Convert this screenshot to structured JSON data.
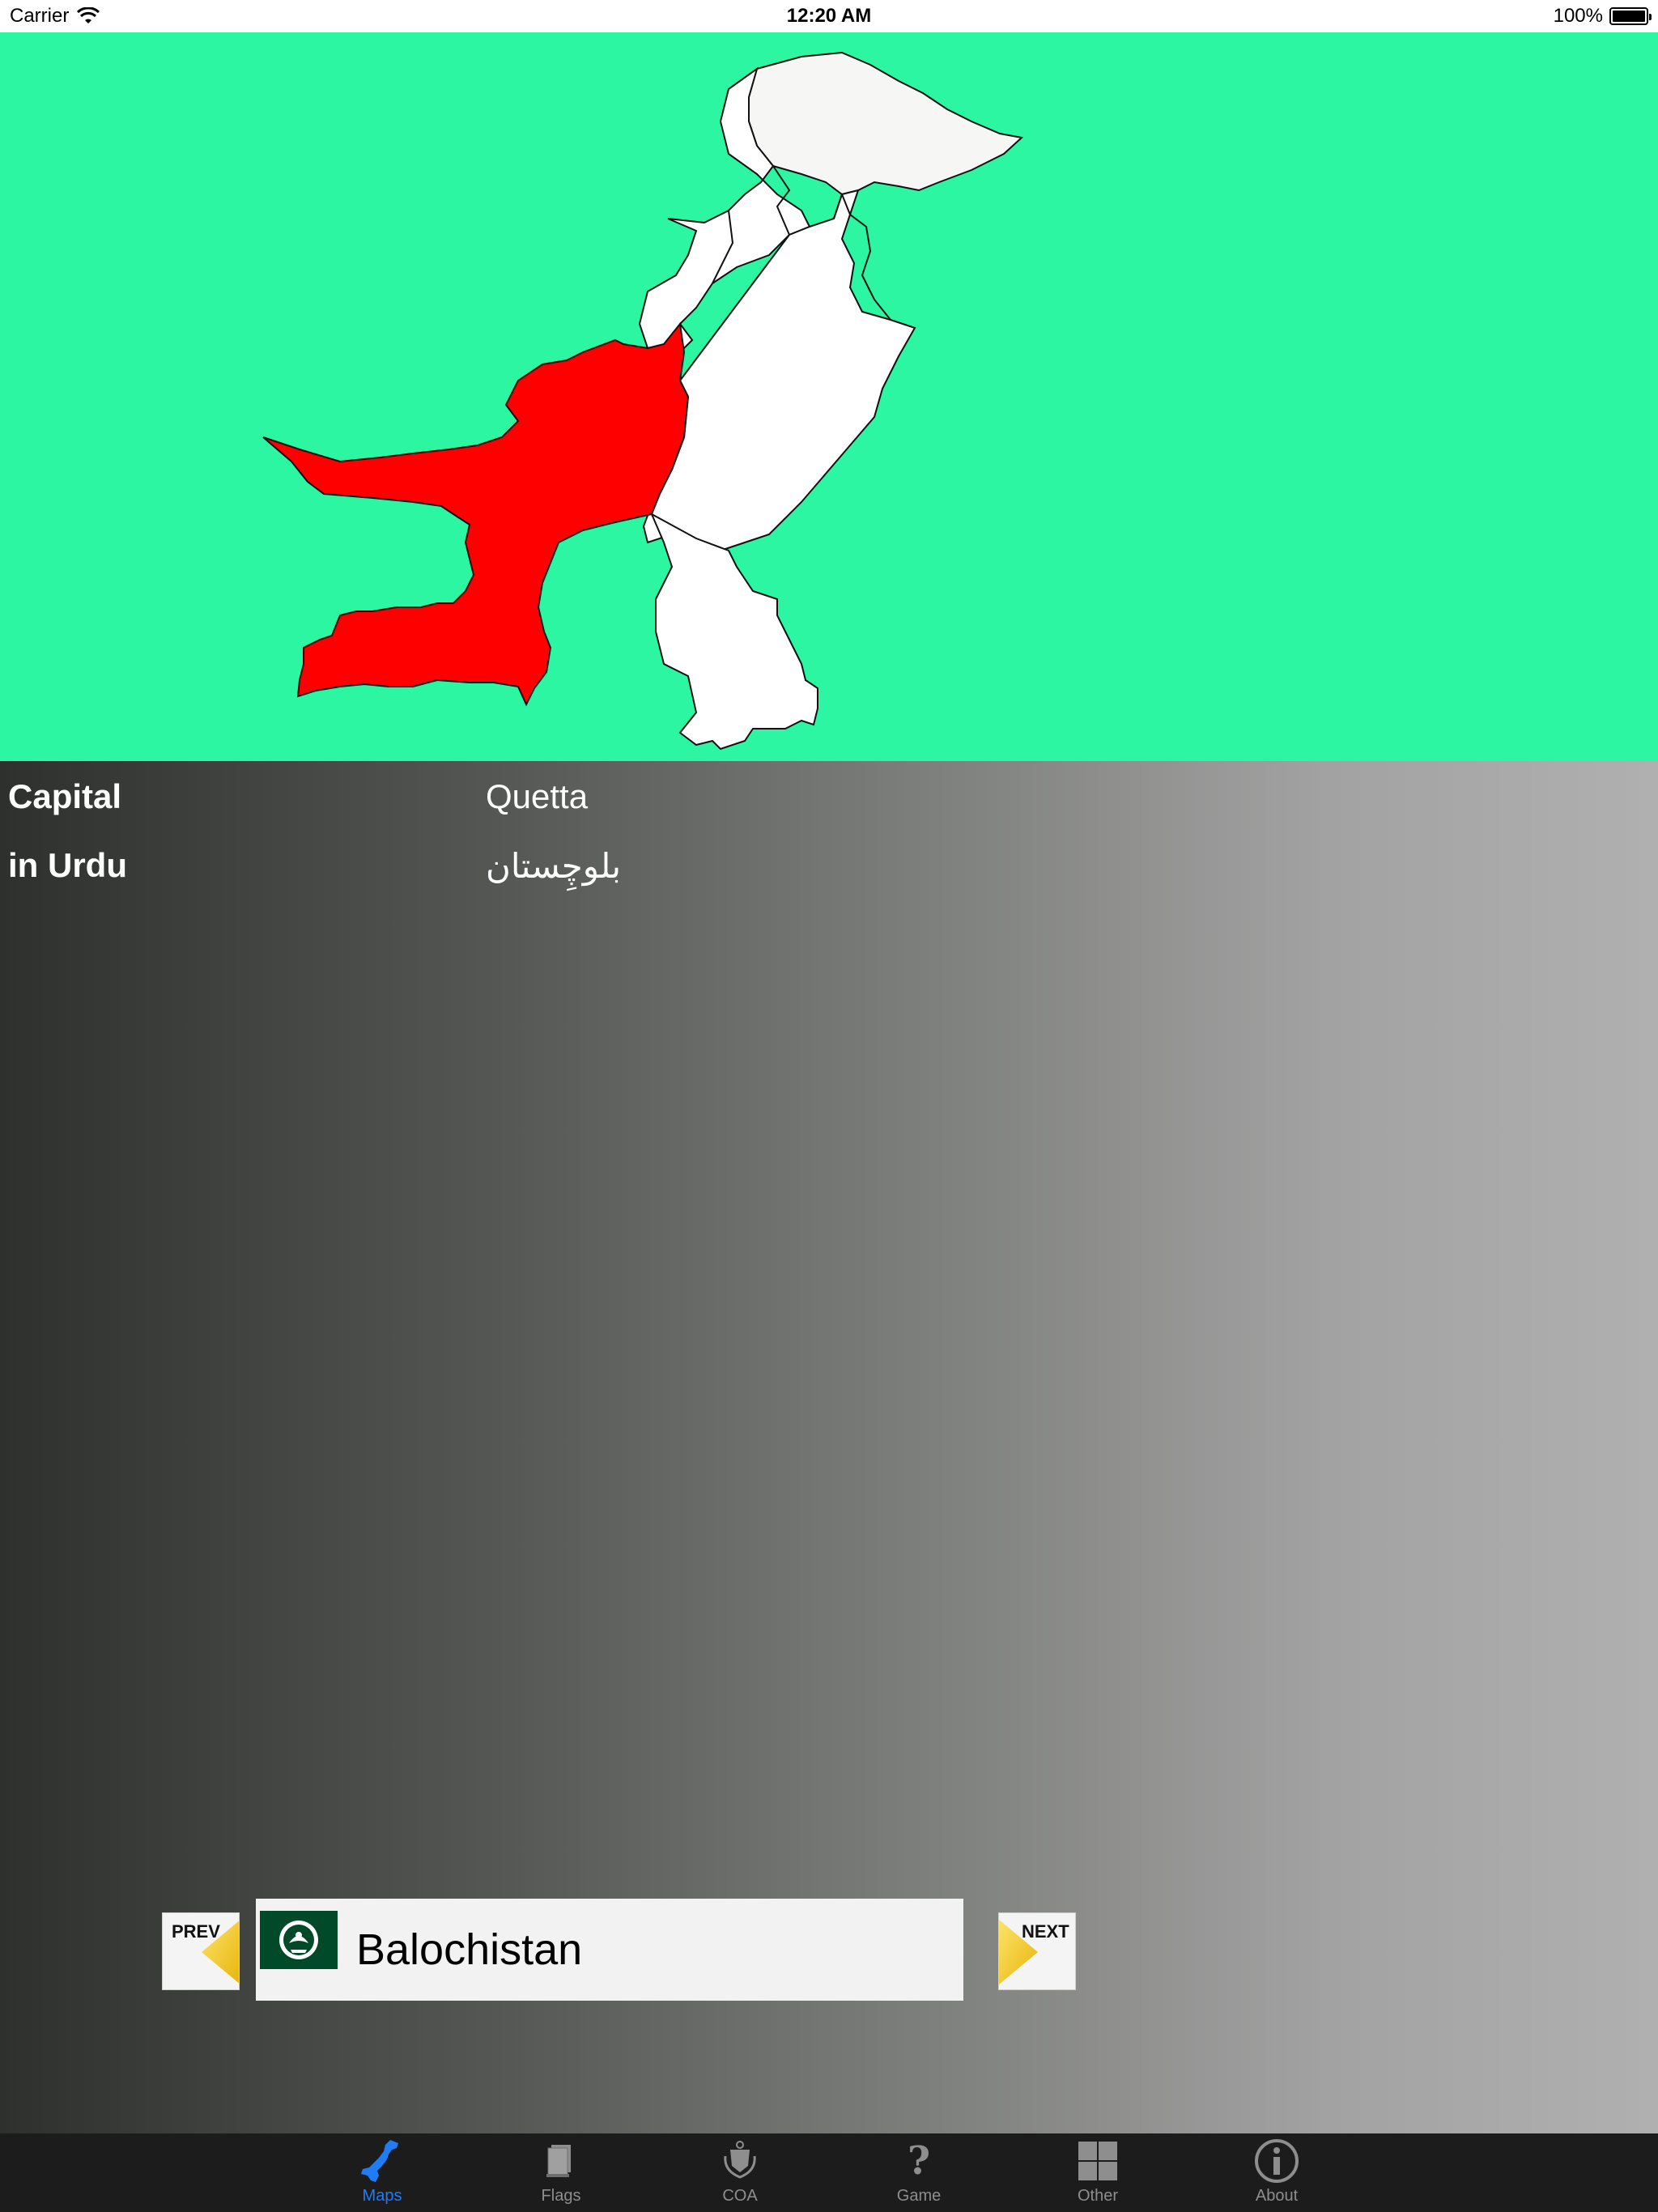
{
  "status_bar": {
    "carrier": "Carrier",
    "time": "12:20 AM",
    "battery": "100%"
  },
  "map": {
    "background_color": "#2cf6a2",
    "highlight_color": "#ff0000",
    "region_color": "#ffffff"
  },
  "info": {
    "capital_label": "Capital",
    "capital_value": "Quetta",
    "urdu_label": "in Urdu",
    "urdu_value": "بلوچِستان"
  },
  "navigation": {
    "prev_label": "PREV",
    "next_label": "NEXT",
    "region_name": "Balochistan",
    "flag_icon": "balochistan-flag-icon"
  },
  "tabs": [
    {
      "label": "Maps",
      "icon": "pakistan-map-icon",
      "active": true
    },
    {
      "label": "Flags",
      "icon": "flag-book-icon",
      "active": false
    },
    {
      "label": "COA",
      "icon": "emblem-icon",
      "active": false
    },
    {
      "label": "Game",
      "icon": "question-icon",
      "active": false
    },
    {
      "label": "Other",
      "icon": "grid-icon",
      "active": false
    },
    {
      "label": "About",
      "icon": "info-icon",
      "active": false
    }
  ],
  "colors": {
    "tab_active": "#1f7cf5",
    "tab_inactive": "#8e8e8e",
    "arrow_yellow": "#f2c418"
  }
}
